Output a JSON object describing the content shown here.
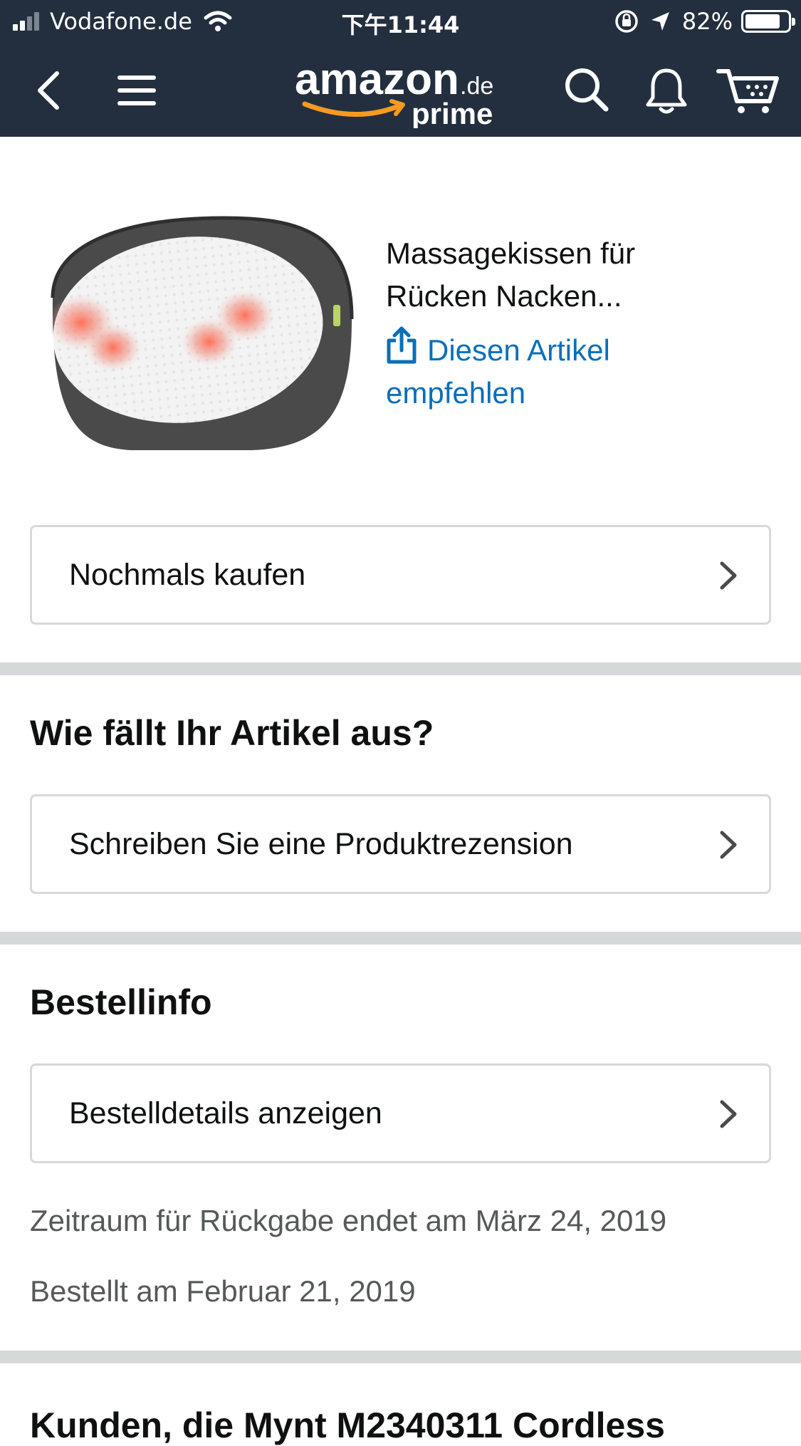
{
  "status_bar": {
    "carrier": "Vodafone.de",
    "time": "下午11:44",
    "battery": "82%",
    "battery_level": 0.82,
    "icons": [
      "signal-icon",
      "wifi-icon",
      "rotation-lock-icon",
      "location-icon",
      "battery-icon"
    ]
  },
  "navbar": {
    "logo_main": "amazon",
    "logo_suffix": ".de",
    "logo_sub": "prime",
    "icons": [
      "back-icon",
      "menu-icon",
      "search-icon",
      "bell-icon",
      "cart-icon"
    ]
  },
  "colors": {
    "header_bg": "#232f3e",
    "link": "#0a6fb8",
    "logo_orange": "#f79a1f",
    "divider": "#d5d9d9"
  },
  "product": {
    "title_line1": "Massagekissen für",
    "title_line2": "Rücken Nacken...",
    "share_label_line1": "Diesen Artikel",
    "share_label_line2": "empfehlen"
  },
  "buy_again": {
    "label": "Nochmals kaufen"
  },
  "review_section": {
    "title": "Wie fällt Ihr Artikel aus?",
    "button_label": "Schreiben Sie eine Produktrezension"
  },
  "order_info": {
    "title": "Bestellinfo",
    "button_label": "Bestelldetails anzeigen",
    "return_window": "Zeitraum für Rückgabe endet am März 24, 2019",
    "ordered_on": "Bestellt am Februar 21, 2019"
  },
  "more_section": {
    "title_partial": "Kunden, die Mynt M2340311 Cordless"
  }
}
